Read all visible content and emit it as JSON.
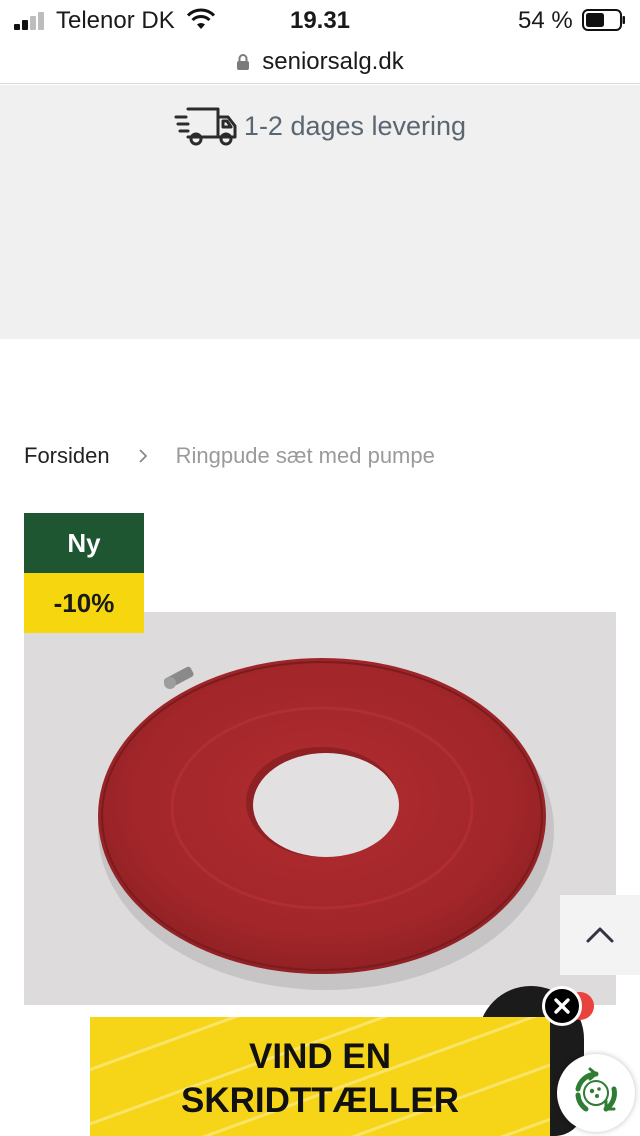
{
  "status_bar": {
    "carrier": "Telenor DK",
    "time": "19.31",
    "battery": "54 %"
  },
  "url_bar": {
    "url": "seniorsalg.dk"
  },
  "delivery": {
    "text": "1-2 dages levering",
    "icon": "delivery-truck-icon"
  },
  "breadcrumb": {
    "home": "Forsiden",
    "current": "Ringpude sæt med pumpe"
  },
  "badges": {
    "new": "Ny",
    "discount": "-10%"
  },
  "colors": {
    "badge_new_bg": "#1e5631",
    "badge_discount_bg": "#f5d60f",
    "promo_bg": "#f6d518",
    "product_red": "#a2262a"
  },
  "promo": {
    "line1": "VIND EN",
    "line2": "SKRIDTTÆLLER"
  }
}
